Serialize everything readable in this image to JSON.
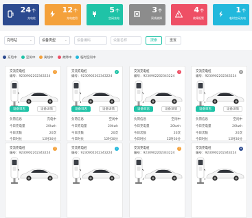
{
  "stats": [
    {
      "value": "24",
      "unit": "个",
      "label": "充电桩",
      "color": "#2c4a8f",
      "icon": "charger-icon"
    },
    {
      "value": "12",
      "unit": "个",
      "label": "充电使用",
      "color": "#f4a13b",
      "icon": "bolt-icon"
    },
    {
      "value": "5",
      "unit": "个",
      "label": "空闲充电",
      "color": "#1fc3a7",
      "icon": "plug-icon"
    },
    {
      "value": "3",
      "unit": "个",
      "label": "离线故障",
      "color": "#8c8c8c",
      "icon": "offline-icon"
    },
    {
      "value": "4",
      "unit": "个",
      "label": "故障报警",
      "color": "#ee4f65",
      "icon": "warning-icon"
    },
    {
      "value": "1",
      "unit": "个",
      "label": "临时空闲充电",
      "color": "#22b8dc",
      "icon": "info-icon"
    }
  ],
  "filters": {
    "station_select": "充电站",
    "type_select": "设备类型",
    "code_placeholder": "设备编码",
    "name_placeholder": "设备名称",
    "search_label": "搜索",
    "reset_label": "重置"
  },
  "legend": [
    {
      "label": "充电中",
      "color": "#2c4a8f"
    },
    {
      "label": "空闲中",
      "color": "#1fc3a7"
    },
    {
      "label": "离线中",
      "color": "#f4a13b"
    },
    {
      "label": "故障中",
      "color": "#ee4f65"
    },
    {
      "label": "临时空闲中",
      "color": "#22b8dc"
    }
  ],
  "cards": [
    {
      "name": "交流充电桩",
      "code": "编号：9230902202343224",
      "status_color": "#f4a13b",
      "status_mark": "!",
      "log_label": "设备日志",
      "detail_label": "设备详情",
      "show_rows": true,
      "rows": [
        {
          "k": "负荷信息",
          "v": "充电中"
        },
        {
          "k": "今日充电量",
          "v": "20kwh"
        },
        {
          "k": "今日次数",
          "v": "20次"
        },
        {
          "k": "今日时长",
          "v": "12时30分"
        }
      ]
    },
    {
      "name": "交流充电桩",
      "code": "编号：9230902202343224",
      "status_color": "#1fc3a7",
      "status_mark": "✓",
      "log_label": "设备日志",
      "detail_label": "设备详情",
      "show_rows": true,
      "rows": [
        {
          "k": "负荷信息",
          "v": "空闲中"
        },
        {
          "k": "今日充电量",
          "v": "20kwh"
        },
        {
          "k": "今日次数",
          "v": "20次"
        },
        {
          "k": "今日时长",
          "v": "12时30分"
        }
      ]
    },
    {
      "name": "交流充电桩",
      "code": "编号：9230902202343224",
      "status_color": "#ee4f65",
      "status_mark": "!",
      "log_label": "设备日志",
      "detail_label": "设备详情",
      "show_rows": true,
      "rows": [
        {
          "k": "负荷信息",
          "v": "空闲中"
        },
        {
          "k": "今日充电量",
          "v": "20kwh"
        },
        {
          "k": "今日次数",
          "v": "20次"
        },
        {
          "k": "今日时长",
          "v": "12时30分"
        }
      ]
    },
    {
      "name": "交流充电桩",
      "code": "编号：9230902202343224",
      "status_color": "#9e9e9e",
      "status_mark": "×",
      "log_label": "设备日志",
      "detail_label": "设备详情",
      "show_rows": true,
      "rows": [
        {
          "k": "负荷信息",
          "v": "空闲中"
        },
        {
          "k": "今日充电量",
          "v": "20kwh"
        },
        {
          "k": "今日次数",
          "v": "20次"
        },
        {
          "k": "今日时长",
          "v": "12时30分"
        }
      ]
    },
    {
      "name": "交流充电桩",
      "code": "编号：9230902202343224",
      "status_color": "#f4a13b",
      "status_mark": "!",
      "log_label": "",
      "detail_label": "",
      "show_rows": false,
      "rows": []
    },
    {
      "name": "交流充电桩",
      "code": "编号：9230902202343224",
      "status_color": "#22b8dc",
      "status_mark": "i",
      "log_label": "",
      "detail_label": "",
      "show_rows": false,
      "rows": []
    },
    {
      "name": "交流充电桩",
      "code": "编号：9230902202343224",
      "status_color": "#f4a13b",
      "status_mark": "!",
      "log_label": "",
      "detail_label": "",
      "show_rows": false,
      "rows": []
    },
    {
      "name": "交流充电桩",
      "code": "编号：9230902202343224",
      "status_color": "#2c4a8f",
      "status_mark": "+",
      "log_label": "",
      "detail_label": "",
      "show_rows": false,
      "rows": []
    }
  ]
}
